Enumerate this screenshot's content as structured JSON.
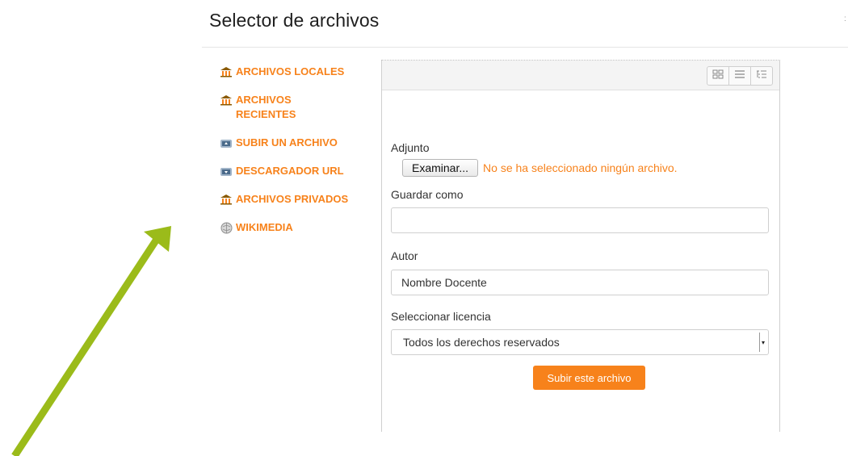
{
  "header": {
    "title": "Selector de archivos",
    "dot": ":"
  },
  "sidebar": {
    "items": [
      {
        "label": "ARCHIVOS LOCALES",
        "icon": "repository-icon"
      },
      {
        "label": "ARCHIVOS RECIENTES",
        "icon": "repository-icon"
      },
      {
        "label": "SUBIR UN ARCHIVO",
        "icon": "upload-icon"
      },
      {
        "label": "DESCARGADOR URL",
        "icon": "download-icon"
      },
      {
        "label": "ARCHIVOS PRIVADOS",
        "icon": "repository-icon"
      },
      {
        "label": "WIKIMEDIA",
        "icon": "wikimedia-icon"
      }
    ]
  },
  "toolbar": {
    "views": [
      "icons-view-icon",
      "list-view-icon",
      "tree-view-icon"
    ]
  },
  "form": {
    "attachment_label": "Adjunto",
    "browse_label": "Examinar...",
    "file_status": "No se ha seleccionado ningún archivo.",
    "save_as_label": "Guardar como",
    "save_as_value": "",
    "author_label": "Autor",
    "author_value": "Nombre Docente",
    "license_label": "Seleccionar licencia",
    "license_value": "Todos los derechos reservados",
    "submit_label": "Subir este archivo"
  },
  "colors": {
    "accent": "#f7821b",
    "arrow": "#9bbb1a"
  }
}
